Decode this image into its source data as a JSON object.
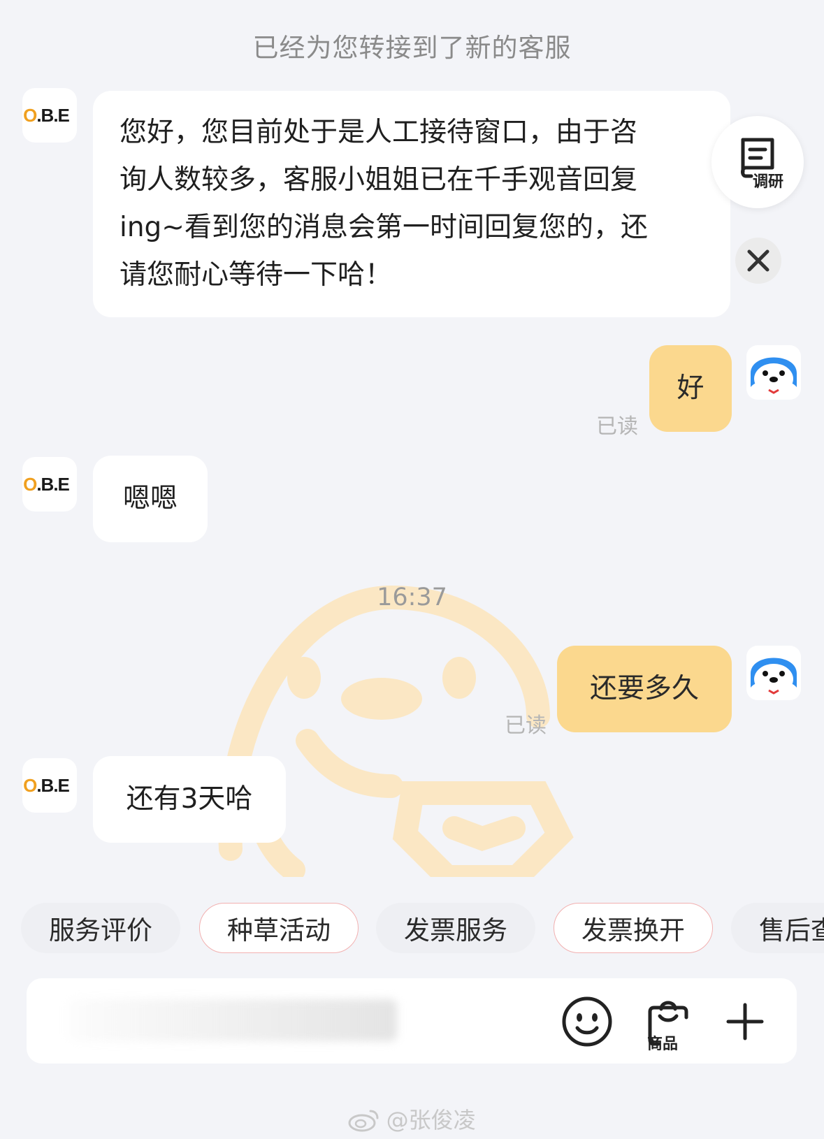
{
  "system_notice": "已经为您转接到了新的客服",
  "shop": {
    "logo_prefix": "O",
    "logo_text": ".B.E"
  },
  "messages": [
    {
      "from": "agent",
      "text": "您好，您目前处于是人工接待窗口，由于咨询人数较多，客服小姐姐已在千手观音回复ing~看到您的消息会第一时间回复您的，还请您耐心等待一下哈！",
      "lines": [
        "您好，您目前处于是人工接待窗口，由于咨",
        "询人数较多，客服小姐姐已在千手观音回复",
        "ing~看到您的消息会第一时间回复您的，还",
        "请您耐心等待一下哈！"
      ]
    },
    {
      "from": "user",
      "text": "好",
      "status": "已读"
    },
    {
      "from": "agent",
      "text": "嗯嗯"
    },
    {
      "from": "user",
      "text": "还要多久",
      "status": "已读"
    },
    {
      "from": "agent",
      "text": "还有3天哈"
    }
  ],
  "timestamp": "16:37",
  "floating": {
    "survey_label": "调研",
    "close_icon": "close-icon"
  },
  "quick_actions": [
    "服务评价",
    "种草活动",
    "发票服务",
    "发票换开",
    "售后查"
  ],
  "input_bar": {
    "emoji_icon": "smile-icon",
    "product_label": "商品",
    "plus_icon": "plus-icon"
  },
  "attribution": "@张俊凌",
  "colors": {
    "background": "#f3f4f8",
    "user_bubble": "#fbd88e",
    "agent_bubble": "#ffffff",
    "chip_border": "#f2b0b0"
  }
}
